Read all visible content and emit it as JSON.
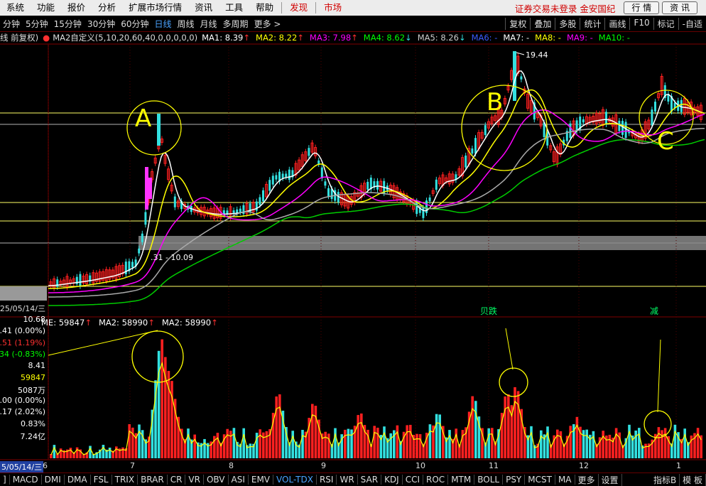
{
  "menu": {
    "items": [
      "系统",
      "功能",
      "报价",
      "分析",
      "扩展市场行情",
      "资讯",
      "工具",
      "帮助"
    ],
    "red_items": [
      "发现",
      "市场"
    ],
    "status_text": "证券交易未登录",
    "broker": "金安国纪",
    "btn_quote": "行 情",
    "btn_news": "资 讯"
  },
  "periods": {
    "items": [
      "分钟",
      "5分钟",
      "15分钟",
      "30分钟",
      "60分钟",
      "日线",
      "周线",
      "月线",
      "多周期",
      "更多 >"
    ],
    "active": "日线",
    "tools": [
      "复权",
      "叠加",
      "多股",
      "统计",
      "画线",
      "F10",
      "标记",
      "-自适"
    ]
  },
  "ma_line": {
    "prefix": "线 前复权)",
    "indicator": "MA2自定义(5,10,20,60,40,0,0,0,0,0)",
    "items": [
      {
        "label": "MA1: 8.39",
        "arrow": "↑",
        "color": "#ffffff"
      },
      {
        "label": "MA2: 8.22",
        "arrow": "↑",
        "color": "#ffff00"
      },
      {
        "label": "MA3: 7.98",
        "arrow": "↑",
        "color": "#ff00ff"
      },
      {
        "label": "MA4: 8.62",
        "arrow": "↓",
        "color": "#00ff00"
      },
      {
        "label": "MA5: 8.26",
        "arrow": "↓",
        "color": "#cccccc"
      },
      {
        "label": "MA6: -",
        "arrow": "",
        "color": "#3a5cff"
      },
      {
        "label": "MA7: -",
        "arrow": "",
        "color": "#ffffff"
      },
      {
        "label": "MA8: -",
        "arrow": "",
        "color": "#ffff00"
      },
      {
        "label": "MA9: -",
        "arrow": "",
        "color": "#ff00ff"
      },
      {
        "label": "MA10: -",
        "arrow": "",
        "color": "#00ff00"
      }
    ]
  },
  "annotations": {
    "a": "A",
    "b": "B",
    "c": "C",
    "high": "19.44",
    "low_range": ".31 - 10.09",
    "mark1": "贝跌",
    "mark2": "减"
  },
  "left_panel": {
    "date": "25/05/14/三",
    "rows": [
      {
        "text": "10.68",
        "color": "#ffffff"
      },
      {
        "text": "8.41 (0.00%)",
        "color": "#ffffff"
      },
      {
        "text": "8.51 (1.19%)",
        "color": "#ff3030"
      },
      {
        "text": "34 (-0.83%)",
        "color": "#00ff00"
      },
      {
        "text": "8.41",
        "color": "#ffffff"
      },
      {
        "text": "59847",
        "color": "#ffff00"
      },
      {
        "text": "5087万",
        "color": "#ffffff"
      },
      {
        "text": "0.00 (0.00%)",
        "color": "#ffffff"
      },
      {
        "text": "0.17 (2.02%)",
        "color": "#ffffff"
      },
      {
        "text": "0.83%",
        "color": "#ffffff"
      },
      {
        "text": "7.24亿",
        "color": "#ffffff"
      }
    ]
  },
  "vol_line": {
    "items": [
      {
        "label": "ME: 59847",
        "arrow": "↑",
        "color": "#ffffff"
      },
      {
        "label": "MA2: 58990",
        "arrow": "↑",
        "color": "#ffffff"
      },
      {
        "label": "MA2: 58990",
        "arrow": "↑",
        "color": "#ffffff"
      }
    ]
  },
  "xaxis": {
    "date": "5/05/14/三",
    "months": [
      "6",
      "7",
      "8",
      "9",
      "10",
      "11",
      "12",
      "1"
    ]
  },
  "bottom": {
    "items": [
      "]",
      "MACD",
      "DMI",
      "DMA",
      "FSL",
      "TRIX",
      "BRAR",
      "CR",
      "VR",
      "OBV",
      "ASI",
      "EMV",
      "VOL-TDX",
      "RSI",
      "WR",
      "SAR",
      "KDJ",
      "CCI",
      "ROC",
      "MTM",
      "BOLL",
      "PSY",
      "MCST",
      "MA",
      "更多",
      "设置"
    ],
    "active": "VOL-TDX",
    "right1": "指标B",
    "right2": "模 板"
  },
  "colors": {
    "up": "#ff2020",
    "down": "#33e0e0",
    "ma1": "#ffffff",
    "ma2": "#ffff00",
    "ma3": "#ff00ff",
    "ma4": "#00cc00",
    "ma5": "#aaaaaa"
  }
}
